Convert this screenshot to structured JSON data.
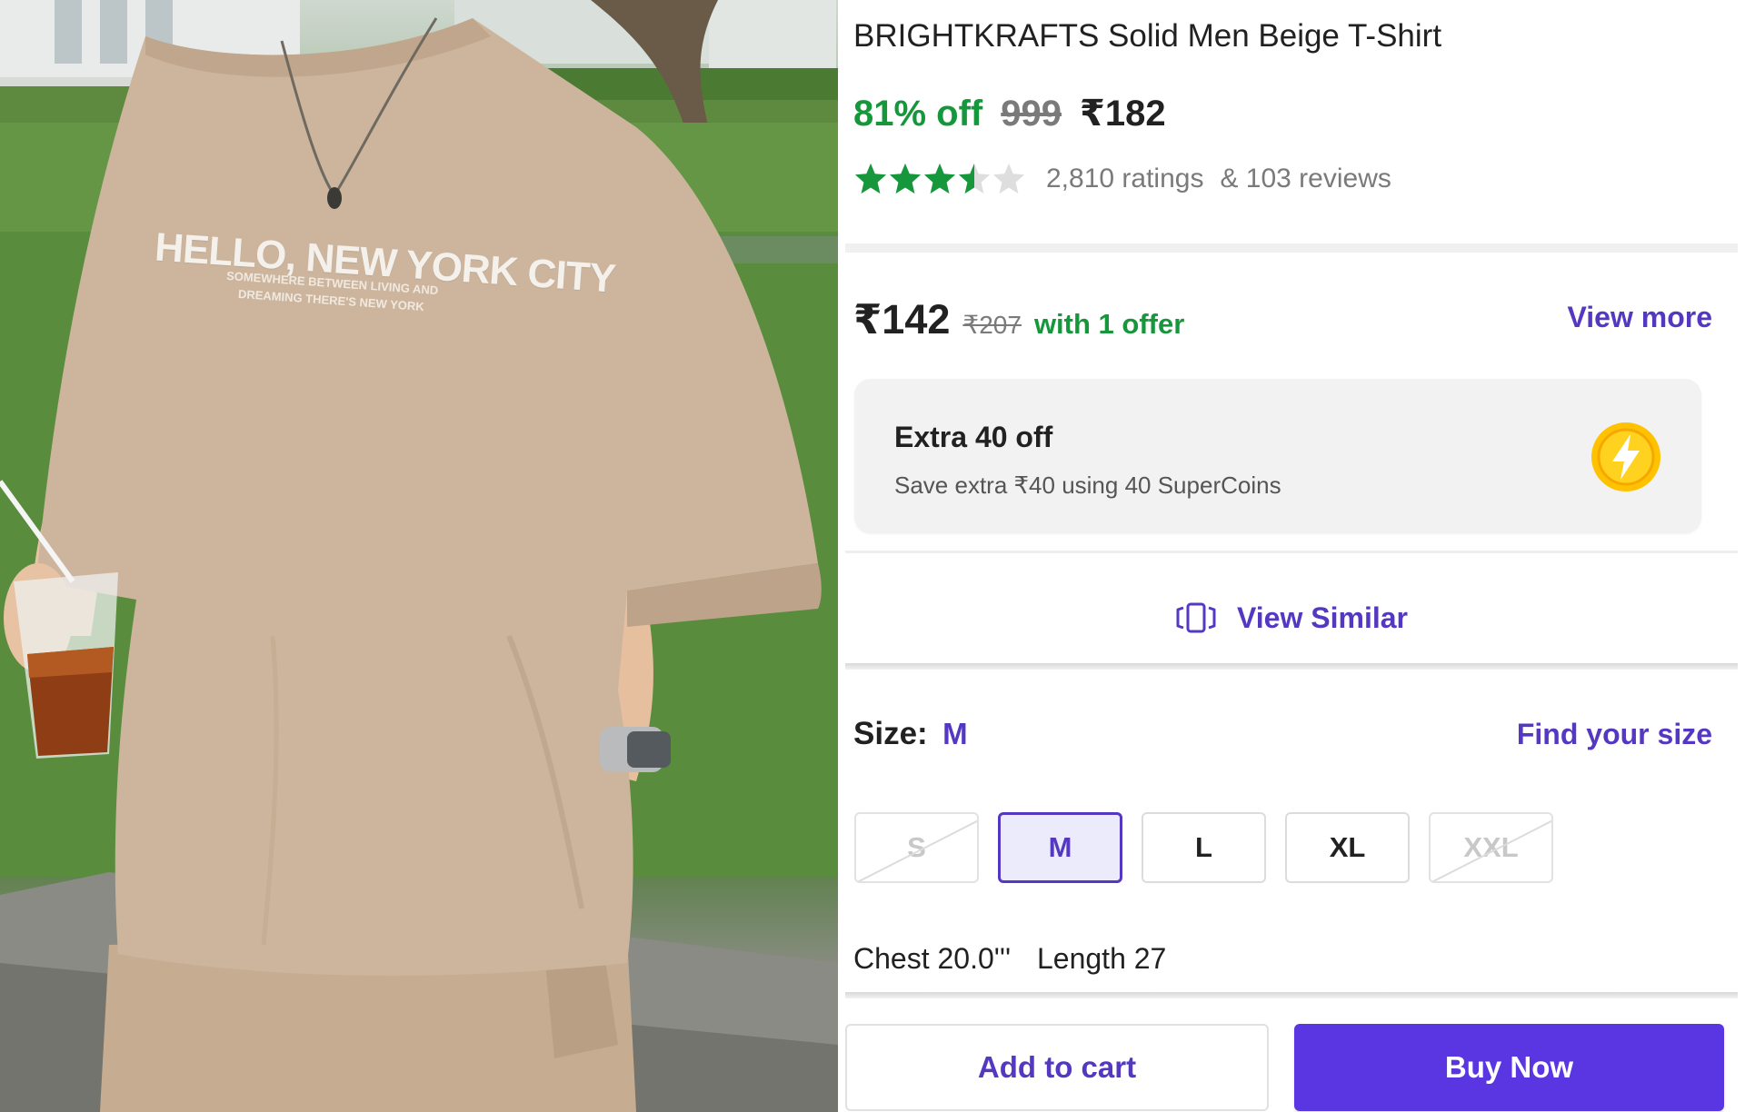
{
  "product_image": {
    "print_title": "HELLO, NEW YORK CITY",
    "print_subtitle_line1": "SOMEWHERE BETWEEN LIVING AND",
    "print_subtitle_line2": "DREAMING THERE'S NEW YORK",
    "shirt_color": "#cdb59d"
  },
  "product": {
    "title": "BRIGHTKRAFTS Solid Men Beige T-Shirt",
    "discount": "81% off",
    "mrp": "999",
    "price": "₹182"
  },
  "rating": {
    "stars_value": 3.5,
    "stars_max": 5,
    "star_color": "#17973c",
    "ratings_count": "2,810 ratings",
    "reviews_count": "& 103 reviews"
  },
  "offer": {
    "price": "₹142",
    "mrp": "₹207",
    "text": "with 1 offer",
    "view_more": "View more"
  },
  "supercoins": {
    "title": "Extra 40 off",
    "subtitle": "Save extra ₹40 using 40 SuperCoins",
    "icon": "lightning-coin-icon"
  },
  "view_similar": {
    "label": "View Similar",
    "icon": "view-similar-icon"
  },
  "size": {
    "label": "Size:",
    "selected": "M",
    "find_size": "Find your size",
    "options": [
      {
        "label": "S",
        "state": "disabled"
      },
      {
        "label": "M",
        "state": "selected"
      },
      {
        "label": "L",
        "state": "available"
      },
      {
        "label": "XL",
        "state": "available"
      },
      {
        "label": "XXL",
        "state": "disabled"
      }
    ]
  },
  "measurements": {
    "chest": "Chest 20.0'''",
    "length": "Length 27"
  },
  "actions": {
    "add_to_cart": "Add to cart",
    "buy_now": "Buy Now"
  },
  "colors": {
    "accent": "#5438c2",
    "buy_button": "#5a36e3",
    "discount_green": "#17973c",
    "coin_yellow": "#ffc200"
  }
}
